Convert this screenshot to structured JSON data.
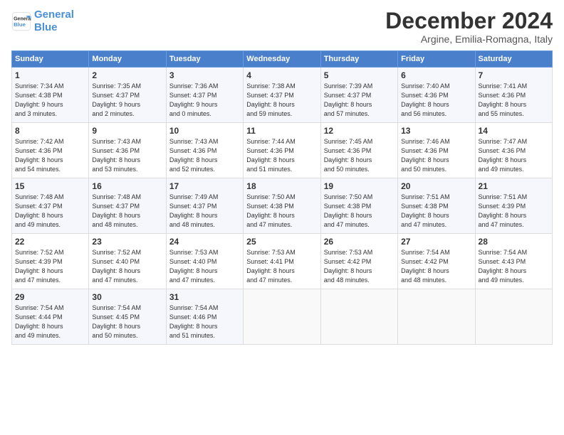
{
  "header": {
    "logo_line1": "General",
    "logo_line2": "Blue",
    "month": "December 2024",
    "location": "Argine, Emilia-Romagna, Italy"
  },
  "days_of_week": [
    "Sunday",
    "Monday",
    "Tuesday",
    "Wednesday",
    "Thursday",
    "Friday",
    "Saturday"
  ],
  "weeks": [
    [
      {
        "day": "1",
        "sunrise": "7:34 AM",
        "sunset": "4:38 PM",
        "daylight": "9 hours and 3 minutes."
      },
      {
        "day": "2",
        "sunrise": "7:35 AM",
        "sunset": "4:37 PM",
        "daylight": "9 hours and 2 minutes."
      },
      {
        "day": "3",
        "sunrise": "7:36 AM",
        "sunset": "4:37 PM",
        "daylight": "9 hours and 0 minutes."
      },
      {
        "day": "4",
        "sunrise": "7:38 AM",
        "sunset": "4:37 PM",
        "daylight": "8 hours and 59 minutes."
      },
      {
        "day": "5",
        "sunrise": "7:39 AM",
        "sunset": "4:37 PM",
        "daylight": "8 hours and 57 minutes."
      },
      {
        "day": "6",
        "sunrise": "7:40 AM",
        "sunset": "4:36 PM",
        "daylight": "8 hours and 56 minutes."
      },
      {
        "day": "7",
        "sunrise": "7:41 AM",
        "sunset": "4:36 PM",
        "daylight": "8 hours and 55 minutes."
      }
    ],
    [
      {
        "day": "8",
        "sunrise": "7:42 AM",
        "sunset": "4:36 PM",
        "daylight": "8 hours and 54 minutes."
      },
      {
        "day": "9",
        "sunrise": "7:43 AM",
        "sunset": "4:36 PM",
        "daylight": "8 hours and 53 minutes."
      },
      {
        "day": "10",
        "sunrise": "7:43 AM",
        "sunset": "4:36 PM",
        "daylight": "8 hours and 52 minutes."
      },
      {
        "day": "11",
        "sunrise": "7:44 AM",
        "sunset": "4:36 PM",
        "daylight": "8 hours and 51 minutes."
      },
      {
        "day": "12",
        "sunrise": "7:45 AM",
        "sunset": "4:36 PM",
        "daylight": "8 hours and 50 minutes."
      },
      {
        "day": "13",
        "sunrise": "7:46 AM",
        "sunset": "4:36 PM",
        "daylight": "8 hours and 50 minutes."
      },
      {
        "day": "14",
        "sunrise": "7:47 AM",
        "sunset": "4:36 PM",
        "daylight": "8 hours and 49 minutes."
      }
    ],
    [
      {
        "day": "15",
        "sunrise": "7:48 AM",
        "sunset": "4:37 PM",
        "daylight": "8 hours and 49 minutes."
      },
      {
        "day": "16",
        "sunrise": "7:48 AM",
        "sunset": "4:37 PM",
        "daylight": "8 hours and 48 minutes."
      },
      {
        "day": "17",
        "sunrise": "7:49 AM",
        "sunset": "4:37 PM",
        "daylight": "8 hours and 48 minutes."
      },
      {
        "day": "18",
        "sunrise": "7:50 AM",
        "sunset": "4:38 PM",
        "daylight": "8 hours and 47 minutes."
      },
      {
        "day": "19",
        "sunrise": "7:50 AM",
        "sunset": "4:38 PM",
        "daylight": "8 hours and 47 minutes."
      },
      {
        "day": "20",
        "sunrise": "7:51 AM",
        "sunset": "4:38 PM",
        "daylight": "8 hours and 47 minutes."
      },
      {
        "day": "21",
        "sunrise": "7:51 AM",
        "sunset": "4:39 PM",
        "daylight": "8 hours and 47 minutes."
      }
    ],
    [
      {
        "day": "22",
        "sunrise": "7:52 AM",
        "sunset": "4:39 PM",
        "daylight": "8 hours and 47 minutes."
      },
      {
        "day": "23",
        "sunrise": "7:52 AM",
        "sunset": "4:40 PM",
        "daylight": "8 hours and 47 minutes."
      },
      {
        "day": "24",
        "sunrise": "7:53 AM",
        "sunset": "4:40 PM",
        "daylight": "8 hours and 47 minutes."
      },
      {
        "day": "25",
        "sunrise": "7:53 AM",
        "sunset": "4:41 PM",
        "daylight": "8 hours and 47 minutes."
      },
      {
        "day": "26",
        "sunrise": "7:53 AM",
        "sunset": "4:42 PM",
        "daylight": "8 hours and 48 minutes."
      },
      {
        "day": "27",
        "sunrise": "7:54 AM",
        "sunset": "4:42 PM",
        "daylight": "8 hours and 48 minutes."
      },
      {
        "day": "28",
        "sunrise": "7:54 AM",
        "sunset": "4:43 PM",
        "daylight": "8 hours and 49 minutes."
      }
    ],
    [
      {
        "day": "29",
        "sunrise": "7:54 AM",
        "sunset": "4:44 PM",
        "daylight": "8 hours and 49 minutes."
      },
      {
        "day": "30",
        "sunrise": "7:54 AM",
        "sunset": "4:45 PM",
        "daylight": "8 hours and 50 minutes."
      },
      {
        "day": "31",
        "sunrise": "7:54 AM",
        "sunset": "4:46 PM",
        "daylight": "8 hours and 51 minutes."
      },
      null,
      null,
      null,
      null
    ]
  ]
}
